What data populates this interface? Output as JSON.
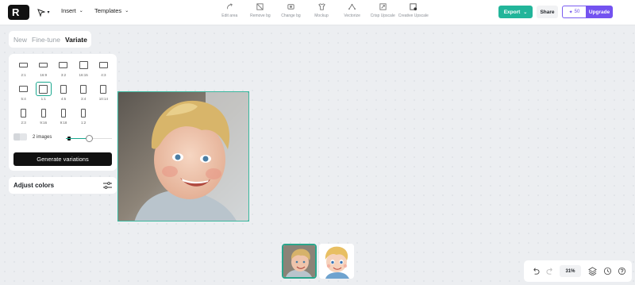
{
  "topbar": {
    "logo_letter": "R",
    "menus": [
      {
        "label": "Insert"
      },
      {
        "label": "Templates"
      }
    ],
    "tools": [
      {
        "label": "Edit area",
        "icon": "edit-area-icon"
      },
      {
        "label": "Remove bg",
        "icon": "remove-bg-icon"
      },
      {
        "label": "Change bg",
        "icon": "change-bg-icon"
      },
      {
        "label": "Mockup",
        "icon": "mockup-icon"
      },
      {
        "label": "Vectorize",
        "icon": "vectorize-icon"
      },
      {
        "label": "Crisp Upscale",
        "icon": "crisp-upscale-icon"
      },
      {
        "label": "Creative Upscale",
        "icon": "creative-upscale-icon"
      }
    ],
    "export_label": "Export",
    "share_label": "Share",
    "credits": "50",
    "upgrade_label": "Upgrade"
  },
  "panel": {
    "tabs": [
      {
        "label": "New",
        "active": false
      },
      {
        "label": "Fine-tune",
        "active": false
      },
      {
        "label": "Variate",
        "active": true
      }
    ],
    "ratios": [
      {
        "label": "2:1",
        "w": 2,
        "h": 1
      },
      {
        "label": "16:9",
        "w": 16,
        "h": 9
      },
      {
        "label": "3:2",
        "w": 3,
        "h": 2
      },
      {
        "label": "16:15",
        "w": 16,
        "h": 15
      },
      {
        "label": "4:3",
        "w": 4,
        "h": 3
      },
      {
        "label": "5:4",
        "w": 5,
        "h": 4
      },
      {
        "label": "1:1",
        "w": 1,
        "h": 1,
        "selected": true
      },
      {
        "label": "4:5",
        "w": 4,
        "h": 5
      },
      {
        "label": "3:4",
        "w": 3,
        "h": 4
      },
      {
        "label": "10:14",
        "w": 10,
        "h": 14
      },
      {
        "label": "2:3",
        "w": 2,
        "h": 3
      },
      {
        "label": "9:16",
        "w": 9,
        "h": 16
      },
      {
        "label": "9:18",
        "w": 9,
        "h": 18
      },
      {
        "label": "1:2",
        "w": 1,
        "h": 2
      }
    ],
    "images_label": "2 images",
    "images_slider_fraction": 0.5,
    "generate_label": "Generate variations",
    "adjust_label": "Adjust colors"
  },
  "bottom": {
    "zoom": "31%"
  },
  "colors": {
    "accent": "#22b59a",
    "upgrade": "#7352f0",
    "canvas": "#eceef1"
  }
}
